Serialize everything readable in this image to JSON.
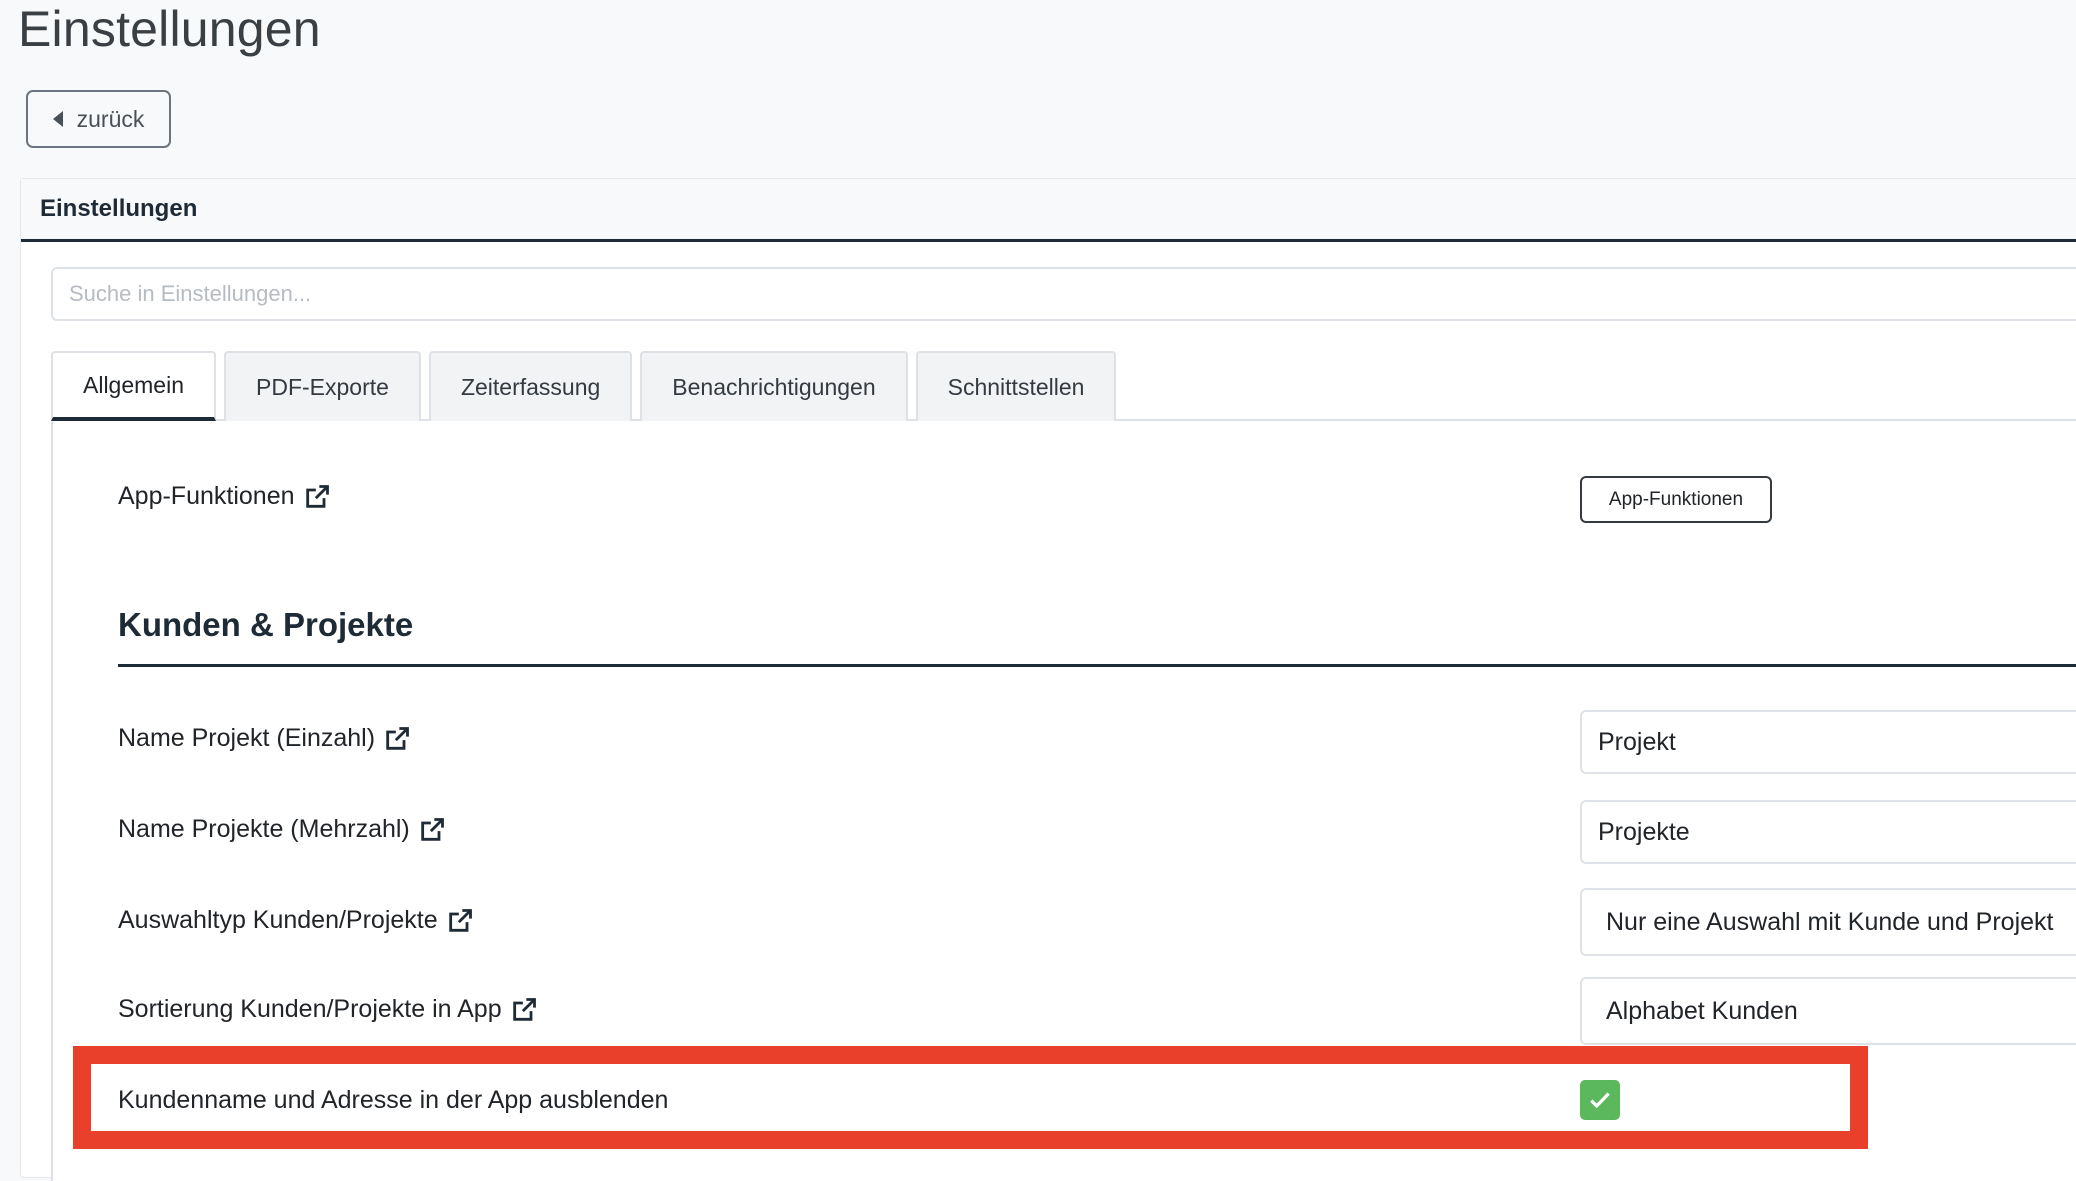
{
  "page": {
    "title": "Einstellungen"
  },
  "back_button": {
    "label": "zurück"
  },
  "card": {
    "header": "Einstellungen"
  },
  "search": {
    "placeholder": "Suche in Einstellungen..."
  },
  "tabs": [
    {
      "label": "Allgemein",
      "active": true
    },
    {
      "label": "PDF-Exporte",
      "active": false
    },
    {
      "label": "Zeiterfassung",
      "active": false
    },
    {
      "label": "Benachrichtigungen",
      "active": false
    },
    {
      "label": "Schnittstellen",
      "active": false
    }
  ],
  "app_functions": {
    "label": "App-Funktionen",
    "button": "App-Funktionen"
  },
  "section": {
    "title": "Kunden & Projekte"
  },
  "settings": [
    {
      "label": "Name Projekt (Einzahl)",
      "value": "Projekt"
    },
    {
      "label": "Name Projekte (Mehrzahl)",
      "value": "Projekte"
    },
    {
      "label": "Auswahltyp Kunden/Projekte",
      "value": "Nur eine Auswahl mit Kunde und Projekt"
    },
    {
      "label": "Sortierung Kunden/Projekte in App",
      "value": "Alphabet Kunden"
    },
    {
      "label": "Kundenname und Adresse in der App ausblenden",
      "checked": true
    }
  ],
  "colors": {
    "accent": "#1e2a36",
    "checkbox": "#5cb85c",
    "highlight": "#e8402a"
  },
  "icons": {
    "back": "caret-left-icon",
    "external": "external-link-icon",
    "check": "check-icon"
  }
}
